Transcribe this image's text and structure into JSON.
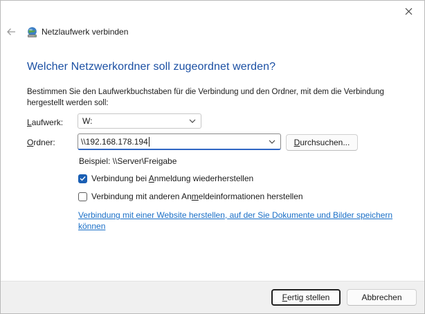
{
  "window": {
    "title": "Netzlaufwerk verbinden"
  },
  "heading": "Welcher Netzwerkordner soll zugeordnet werden?",
  "description": "Bestimmen Sie den Laufwerkbuchstaben für die Verbindung und den Ordner, mit dem die Verbindung hergestellt werden soll:",
  "drive": {
    "label_first": "L",
    "label_rest": "aufwerk:",
    "value": "W:"
  },
  "folder": {
    "label_first": "O",
    "label_rest": "rdner:",
    "value": "\\\\192.168.178.194"
  },
  "browse_button": {
    "first": "D",
    "rest": "urchsuchen..."
  },
  "example": "Beispiel: \\\\Server\\Freigabe",
  "option_reconnect": {
    "before": "Verbindung bei ",
    "accel": "A",
    "after": "nmeldung wiederherstellen",
    "checked": true
  },
  "option_other_credentials": {
    "before": "Verbindung mit anderen An",
    "accel": "m",
    "after": "eldeinformationen herstellen",
    "checked": false
  },
  "website_link": "Verbindung mit einer Website herstellen, auf der Sie Dokumente und Bilder speichern können",
  "footer": {
    "finish": {
      "first": "F",
      "rest": "ertig stellen"
    },
    "cancel": "Abbrechen"
  },
  "icons": {
    "close": "close-icon",
    "back": "back-arrow-icon",
    "app": "network-drive-icon",
    "chevron": "chevron-down-icon",
    "check": "checkmark-icon"
  },
  "colors": {
    "heading": "#1a4fa3",
    "link": "#1a6fc7",
    "checkbox_checked": "#1a5fb4",
    "focus_border": "#2f66c4",
    "footer_bg": "#f0f0f0"
  }
}
